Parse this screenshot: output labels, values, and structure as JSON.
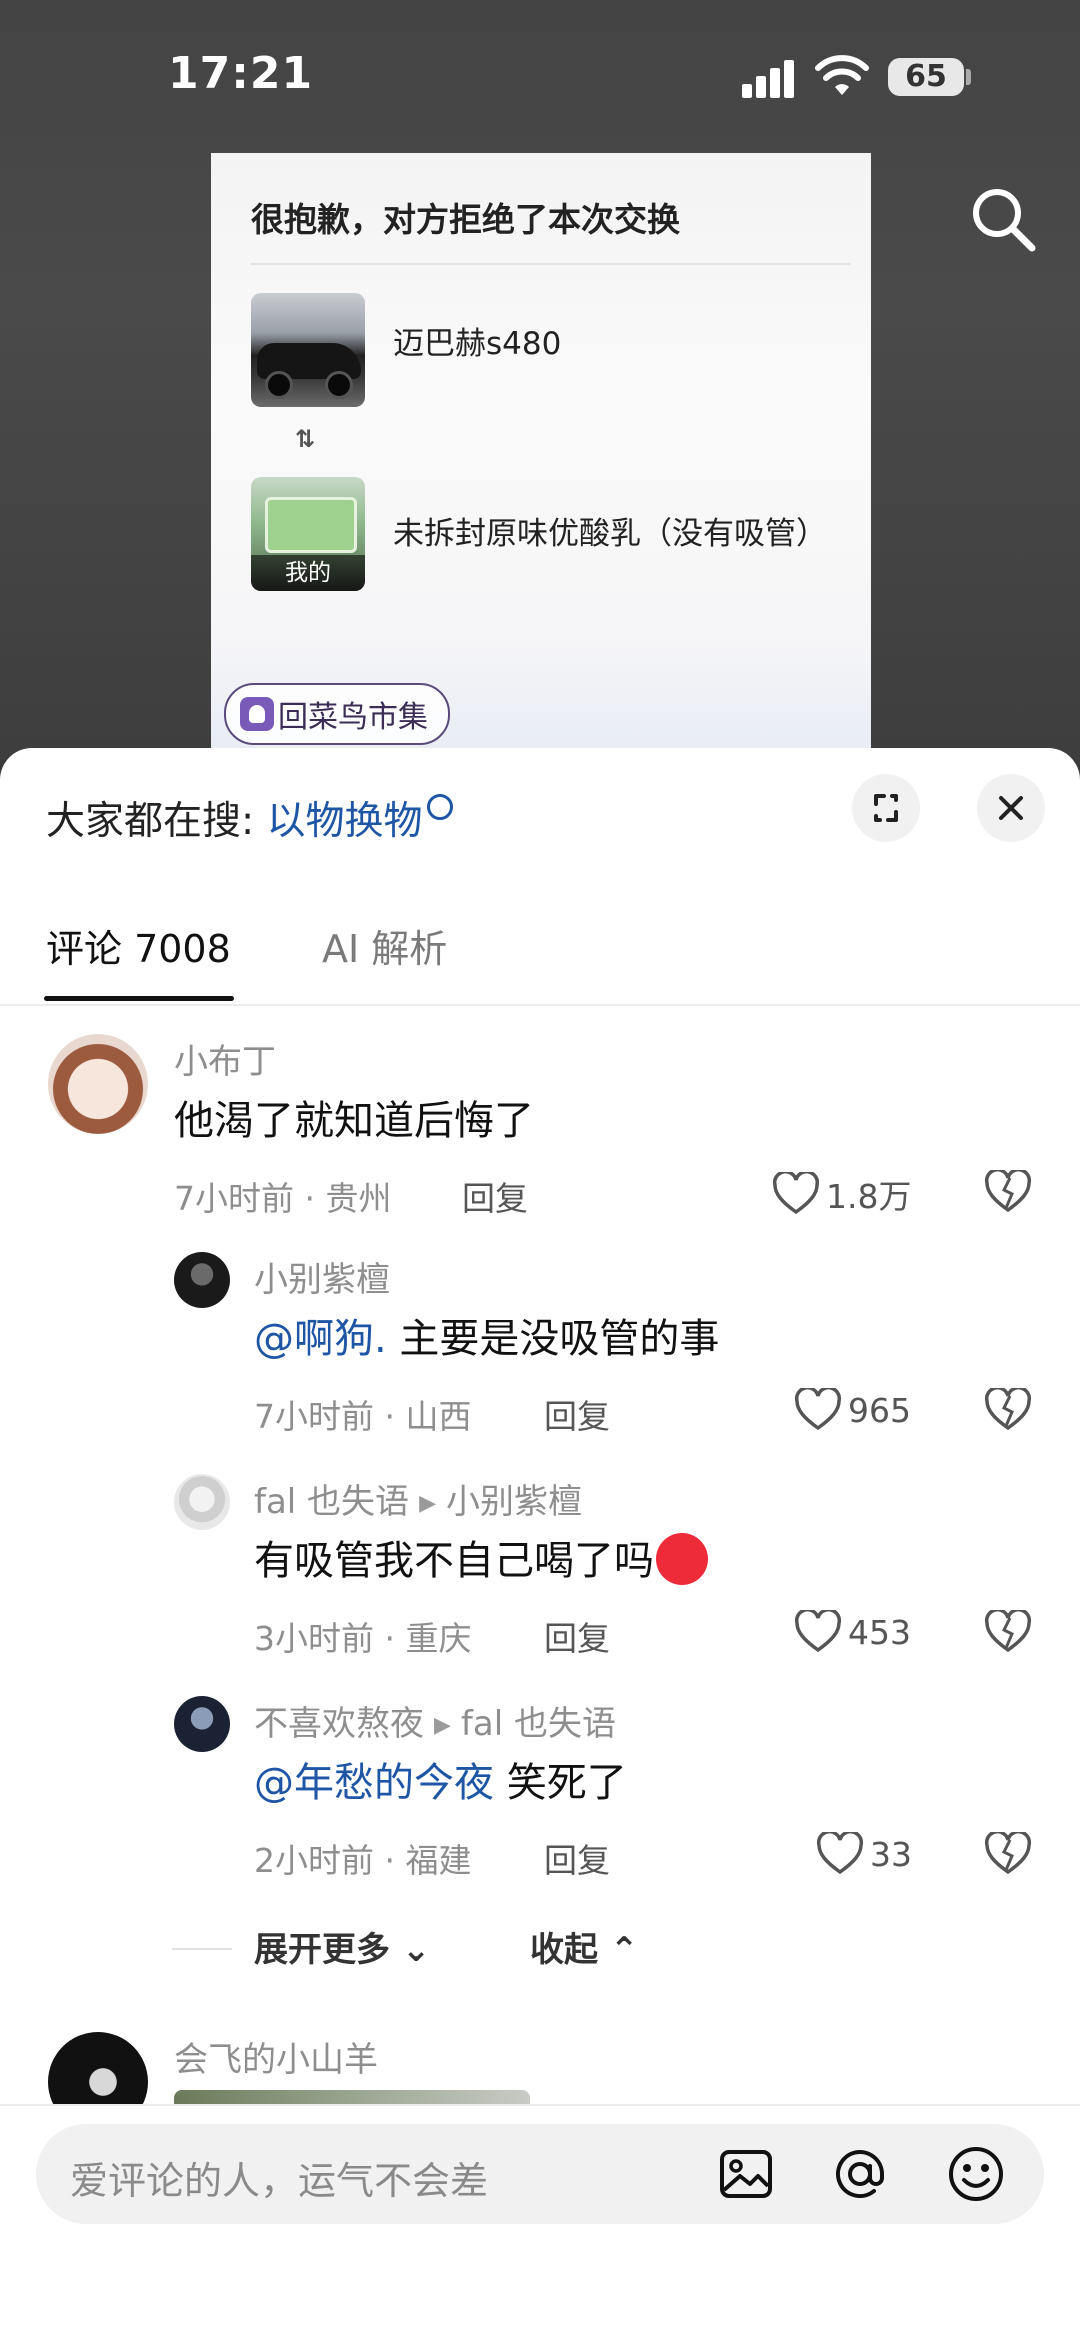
{
  "status_bar": {
    "time": "17:21",
    "battery": "65"
  },
  "exchange_card": {
    "title": "很抱歉，对方拒绝了本次交换",
    "their_item": "迈巴赫s480",
    "swap_icon": "⇅",
    "my_item": "未拆封原味优酸乳（没有吸管）",
    "my_tag": "我的",
    "market_button": "回菜鸟市集"
  },
  "sheet": {
    "suggest_prefix": "大家都在搜:",
    "suggest_term": "以物换物",
    "tabs": [
      {
        "label": "评论 7008"
      },
      {
        "label": "AI 解析"
      }
    ]
  },
  "comments": [
    {
      "user": "小布丁",
      "text": "他渴了就知道后悔了",
      "meta": "7小时前 · 贵州",
      "reply": "回复",
      "likes": "1.8万"
    },
    {
      "user": "小别紫檀",
      "at": "@啊狗.",
      "text": " 主要是没吸管的事",
      "meta": "7小时前 · 山西",
      "reply": "回复",
      "likes": "965"
    },
    {
      "user": "fal 也失语",
      "reply_to": "小别紫檀",
      "text": "有吸管我不自己喝了吗",
      "meta": "3小时前 · 重庆",
      "reply": "回复",
      "likes": "453"
    },
    {
      "user": "不喜欢熬夜",
      "reply_to": "fal 也失语",
      "at": "@年愁的今夜",
      "text": " 笑死了",
      "meta": "2小时前 · 福建",
      "reply": "回复",
      "likes": "33"
    },
    {
      "user": "会飞的小山羊"
    }
  ],
  "thread_controls": {
    "expand": "展开更多",
    "collapse": "收起"
  },
  "input": {
    "placeholder": "爱评论的人，运气不会差"
  },
  "icons": [
    "search-icon",
    "expand-icon",
    "close-icon",
    "heart-icon",
    "dislike-icon",
    "image-icon",
    "at-icon",
    "emoji-icon"
  ]
}
